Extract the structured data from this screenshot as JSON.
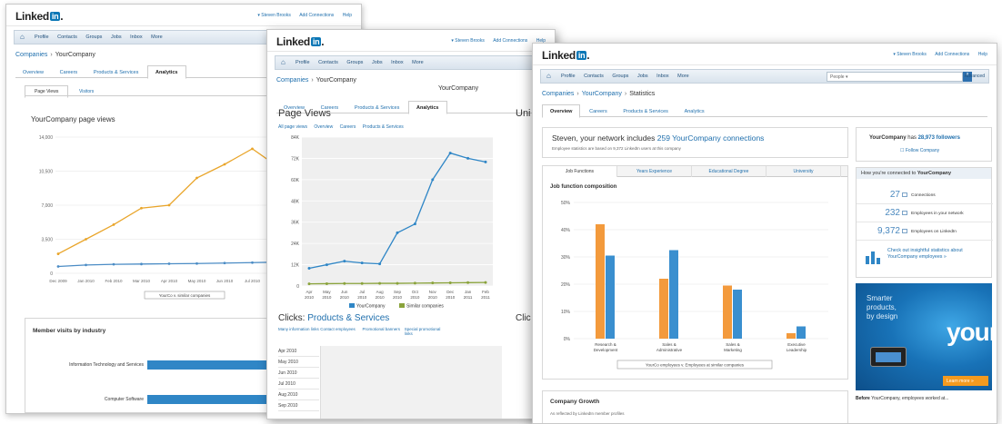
{
  "brand": {
    "logo_text": "Linked",
    "logo_badge": "in",
    "logo_mark": "."
  },
  "win1": {
    "userlinks": [
      "▾ Steven Brooks",
      "Add Connections",
      "Help"
    ],
    "nav": [
      "Profile",
      "Contacts",
      "Groups",
      "Jobs",
      "Inbox",
      "More"
    ],
    "crumb": {
      "parent": "Companies",
      "sep": "›",
      "current": "YourCompany"
    },
    "tabs": [
      "Overview",
      "Careers",
      "Products & Services",
      "Analytics"
    ],
    "subtabs": [
      "Page Views",
      "Visitors"
    ],
    "page_views_title": "YourCompany page views",
    "compare_button": "YourCo v. similar companies",
    "member_title": "Member visits by industry",
    "industries": [
      "Information Technology and Services",
      "Computer Software"
    ],
    "industry_values": [
      100,
      62
    ]
  },
  "win2": {
    "userlinks": [
      "▾ Steven Brooks",
      "Add Connections",
      "Help"
    ],
    "nav": [
      "Profile",
      "Contacts",
      "Groups",
      "Jobs",
      "Inbox",
      "More"
    ],
    "crumb": {
      "parent": "Companies",
      "sep": "›",
      "current": "YourCompany"
    },
    "company_name": "YourCompany",
    "tabs": [
      "Overview",
      "Careers",
      "Products & Services",
      "Analytics"
    ],
    "page_views_title": "Page Views",
    "links": [
      "All page views",
      "Overview",
      "Careers",
      "Products & Services"
    ],
    "unique_title": "Uni",
    "clicks_title_a": "Clicks: ",
    "clicks_title_b": "Products & Services",
    "clicks_title_cut": "Clic",
    "columns": [
      "Many information links",
      "Contact employees",
      "Promotional banners",
      "Special promotional links"
    ],
    "months": [
      "Apr 2010",
      "May 2010",
      "Jun 2010",
      "Jul 2010",
      "Aug 2010",
      "Sep 2010"
    ]
  },
  "win3": {
    "userlinks": [
      "▾ Steven Brooks",
      "Add Connections",
      "Help"
    ],
    "nav": [
      "Profile",
      "Contacts",
      "Groups",
      "Jobs",
      "Inbox",
      "More"
    ],
    "search_placeholder": "People ▾",
    "advanced": "Advanced",
    "crumb": {
      "parent": "Companies",
      "sep": "›",
      "middle": "YourCompany",
      "current": "Statistics"
    },
    "tabs": [
      "Overview",
      "Careers",
      "Products & Services",
      "Analytics"
    ],
    "network_text_a": "Steven, your network includes ",
    "network_text_b": "259 YourCompany connections",
    "network_sub": "Employee statistics are based on 9,372 LinkedIn users at this company",
    "jf_tabs": [
      "Job Functions",
      "Years Experience",
      "Educational Degree",
      "University"
    ],
    "jf_title": "Job function composition",
    "growth_title": "Company Growth",
    "growth_sub": "As reflected by LinkedIn member profiles",
    "follow_a": "YourCompany",
    "follow_b": " has ",
    "follow_c": "28,973 followers",
    "follow_button": "☐ Follow Company",
    "connected_header_a": "How you're connected to ",
    "connected_header_b": "YourCompany",
    "connections": [
      {
        "num": "27",
        "label": "Connections"
      },
      {
        "num": "232",
        "label": "Employees in your network"
      },
      {
        "num": "9,372",
        "label": "Employees on LinkedIn"
      }
    ],
    "insight_text": "Check out insightful statistics about YourCompany employees »",
    "ad": {
      "line1": "Smarter",
      "line2": "products,",
      "line3": "by design",
      "big": "your",
      "button": "Learn more »"
    },
    "footer_a": "Before",
    "footer_b": " YourCompany, employees worked at..."
  },
  "chart_data": [
    {
      "type": "line",
      "title": "YourCompany page views",
      "x": [
        "Dec 2009",
        "Jan 2010",
        "Feb 2010",
        "Mar 2010",
        "Apr 2010",
        "May 2010",
        "Jun 2010",
        "Jul 2010"
      ],
      "y_ticks": [
        "0",
        "3,500",
        "7,000",
        "10,500",
        "14,000"
      ],
      "ylim": [
        0,
        14000
      ],
      "series": [
        {
          "name": "YourCo",
          "color": "#e9a52a",
          "values": [
            2000,
            3500,
            5000,
            6700,
            7000,
            9800,
            11200,
            12800,
            10800
          ]
        },
        {
          "name": "similar companies",
          "color": "#4b8cc5",
          "values": [
            700,
            850,
            920,
            950,
            980,
            1000,
            1050,
            1100,
            1150
          ]
        }
      ],
      "legend": "YourCo v. similar companies"
    },
    {
      "type": "area",
      "title": "Page Views",
      "x": [
        "Apr 2010",
        "May 2010",
        "Jun 2010",
        "Jul 2010",
        "Aug 2010",
        "Sep 2010",
        "Oct 2010",
        "Nov 2010",
        "Dec 2010",
        "Jan 2011",
        "Feb 2011"
      ],
      "y_ticks": [
        "0",
        "12K",
        "24K",
        "36K",
        "48K",
        "60K",
        "72K",
        "84K"
      ],
      "ylim": [
        0,
        84000
      ],
      "series": [
        {
          "name": "YourCompany",
          "color": "#2f86c6",
          "values": [
            10000,
            12000,
            14000,
            13000,
            12500,
            30000,
            35000,
            60000,
            75000,
            72000,
            70000
          ]
        },
        {
          "name": "Similar companies",
          "color": "#8aa33b",
          "values": [
            1200,
            1300,
            1400,
            1400,
            1500,
            1500,
            1600,
            1700,
            1800,
            1900,
            2000
          ]
        }
      ],
      "legend": [
        "YourCompany",
        "Similar companies"
      ]
    },
    {
      "type": "bar",
      "title": "Job function composition",
      "categories": [
        "Research & Development",
        "Sales & Administrative",
        "Sales & Marketing",
        "Executive Leadership"
      ],
      "y_ticks": [
        "0%",
        "10%",
        "20%",
        "30%",
        "40%",
        "50%"
      ],
      "ylim": [
        0,
        50
      ],
      "series": [
        {
          "name": "YourCo employees",
          "color": "#f39a3c",
          "values": [
            42,
            22,
            19.5,
            2
          ]
        },
        {
          "name": "Employees at similar companies",
          "color": "#3a8fcf",
          "values": [
            30.5,
            32.5,
            18,
            4.5
          ]
        }
      ],
      "legend": "YourCo employees v. Employees at similar companies"
    }
  ]
}
